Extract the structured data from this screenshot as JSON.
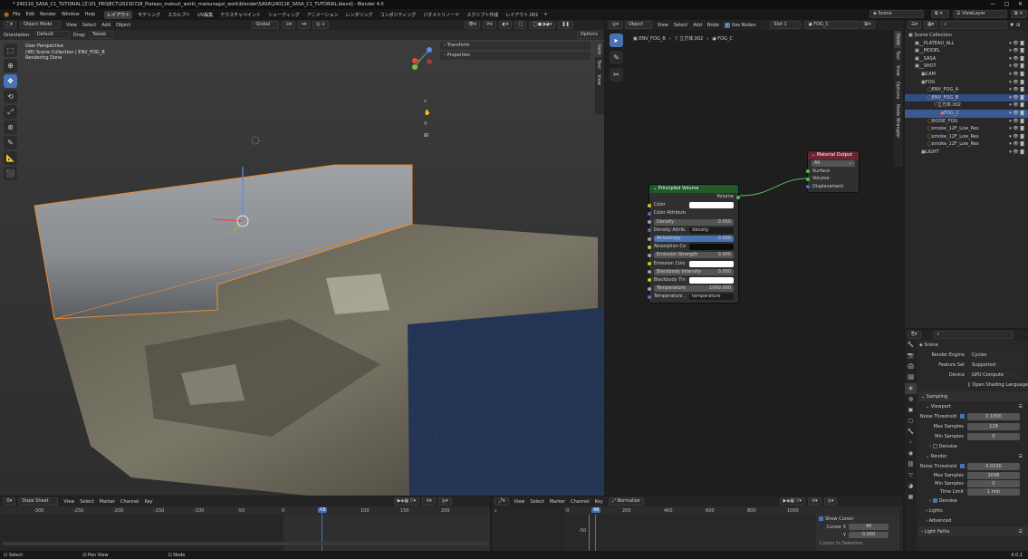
{
  "window": {
    "title": "* 240116_SASA_C1_TUTORIAL [Z:\\01_PROJECT\\20230728_Plateau_matsui\\_work\\_matsunaga\\_work\\blender\\SASA\\240116_SASA_C1_TUTORIAL.blend] - Blender 4.0",
    "scene_label": "Scene",
    "view_layer": "ViewLayer"
  },
  "menu": {
    "items": [
      "File",
      "Edit",
      "Render",
      "Window",
      "Help"
    ],
    "workspaces": [
      "レイアウト",
      "モデリング",
      "スカルプト",
      "UV編集",
      "テクスチャペイント",
      "シェーディング",
      "アニメーション",
      "レンダリング",
      "コンポジティング",
      "ジオメトリノード",
      "スクリプト作成",
      "レイアウト.001",
      "+"
    ],
    "active_workspace": "レイアウト"
  },
  "viewport": {
    "mode": "Object Mode",
    "header_menus": [
      "View",
      "Select",
      "Add",
      "Object"
    ],
    "transform_orientation": "Global",
    "orientation_label": "Orientation:",
    "orientation_value": "Default",
    "drag_label": "Drag:",
    "drag_value": "Tweak",
    "options_label": "Options",
    "overlay_lines": [
      "User Perspective",
      "(48) Scene Collection | ENV_FOG_B",
      "Rendering Done"
    ],
    "n_panel": {
      "transform": "Transform",
      "properties": "Properties"
    },
    "side_tabs": [
      "Item",
      "Tool",
      "View"
    ]
  },
  "node_editor": {
    "editor_type": "Object",
    "menus": [
      "View",
      "Select",
      "Add",
      "Node"
    ],
    "use_nodes": "Use Nodes",
    "slot": "Slot 1",
    "material": "FOG_C",
    "breadcrumb": [
      "ENV_FOG_B",
      "立方体.002",
      "FOG_C"
    ],
    "side_tabs": [
      "Node",
      "Tool",
      "View",
      "Options",
      "Node Wrangler"
    ],
    "principled": {
      "title": "Principled Volume",
      "output": "Volume",
      "rows": [
        {
          "label": "Color",
          "kind": "color",
          "value": ""
        },
        {
          "label": "Color Attribute",
          "kind": "text",
          "value": ""
        },
        {
          "label": "Density",
          "kind": "num",
          "value": "0.050"
        },
        {
          "label": "Density Attrib...",
          "kind": "text",
          "value": "density"
        },
        {
          "label": "Anisotropy",
          "kind": "num",
          "value": "0.000"
        },
        {
          "label": "Absorption Co...",
          "kind": "dark",
          "value": ""
        },
        {
          "label": "Emission Strength",
          "kind": "num",
          "value": "0.000"
        },
        {
          "label": "Emission Color",
          "kind": "color",
          "value": ""
        },
        {
          "label": "Blackbody Intensity",
          "kind": "num",
          "value": "0.000"
        },
        {
          "label": "Blackbody Tint",
          "kind": "color",
          "value": ""
        },
        {
          "label": "Temperature",
          "kind": "num",
          "value": "1000.000"
        },
        {
          "label": "Temperature ...",
          "kind": "text",
          "value": "temperature"
        }
      ]
    },
    "output": {
      "title": "Material Output",
      "target": "All",
      "inputs": [
        "Surface",
        "Volume",
        "Displacement"
      ]
    }
  },
  "outliner": {
    "root": "Scene Collection",
    "rows": [
      {
        "label": "__PLATEAU_ALL",
        "depth": 1,
        "sel": ""
      },
      {
        "label": "__MODEL",
        "depth": 1,
        "sel": ""
      },
      {
        "label": "__SASA",
        "depth": 1,
        "sel": ""
      },
      {
        "label": "__SHOT",
        "depth": 1,
        "sel": ""
      },
      {
        "label": "CAM",
        "depth": 2,
        "sel": ""
      },
      {
        "label": "FOG",
        "depth": 2,
        "sel": ""
      },
      {
        "label": "ENV_FOG_A",
        "depth": 3,
        "sel": ""
      },
      {
        "label": "ENV_FOG_B",
        "depth": 3,
        "sel": "sel"
      },
      {
        "label": "立方体.002",
        "depth": 4,
        "sel": ""
      },
      {
        "label": "FOG_C",
        "depth": 5,
        "sel": "sel2"
      },
      {
        "label": "NOISE_FOG",
        "depth": 3,
        "sel": ""
      },
      {
        "label": "smoke_12F_Low_Res",
        "depth": 3,
        "sel": ""
      },
      {
        "label": "smoke_12F_Low_Res",
        "depth": 3,
        "sel": ""
      },
      {
        "label": "smoke_12F_Low_Res",
        "depth": 3,
        "sel": ""
      },
      {
        "label": "LIGHT",
        "depth": 2,
        "sel": ""
      }
    ]
  },
  "properties": {
    "context": "Scene",
    "render_engine_label": "Render Engine",
    "render_engine": "Cycles",
    "feature_set_label": "Feature Set",
    "feature_set": "Supported",
    "device_label": "Device",
    "device": "GPU Compute",
    "osl": "Open Shading Language",
    "sampling": "Sampling",
    "viewport": "Viewport",
    "noise_threshold_label": "Noise Threshold",
    "vp_noise": "0.1000",
    "max_samples_label": "Max Samples",
    "vp_max": "128",
    "min_samples_label": "Min Samples",
    "vp_min": "0",
    "denoise": "Denoise",
    "render": "Render",
    "r_noise": "0.0100",
    "r_max": "2048",
    "r_min": "0",
    "time_limit_label": "Time Limit",
    "time_limit": "1 min",
    "denoise2": "Denoise",
    "lights": "Lights",
    "advanced": "Advanced",
    "light_paths": "Light Paths"
  },
  "dopesheet": {
    "mode": "Dope Sheet",
    "menus": [
      "View",
      "Select",
      "Marker",
      "Channel",
      "Key"
    ],
    "ticks": [
      "-300",
      "-250",
      "-200",
      "-150",
      "-100",
      "-50",
      "0",
      "48",
      "100",
      "150",
      "200"
    ],
    "current_frame": "48"
  },
  "graph": {
    "menus": [
      "View",
      "Select",
      "Marker",
      "Channel",
      "Key"
    ],
    "normalize": "Normalize",
    "ticks": [
      "0",
      "48",
      "200",
      "400",
      "600",
      "800",
      "1000"
    ],
    "y_value": "-50",
    "show_cursor": "Show Cursor",
    "cursor_x_label": "Cursor X",
    "cursor_x": "48",
    "cursor_y_label": "Y",
    "cursor_y": "0.000",
    "cursor_to_selection": "Cursor to Selection"
  },
  "status": {
    "select": "Select",
    "pan": "Pan View",
    "node": "Node",
    "version": "4.0.1"
  }
}
